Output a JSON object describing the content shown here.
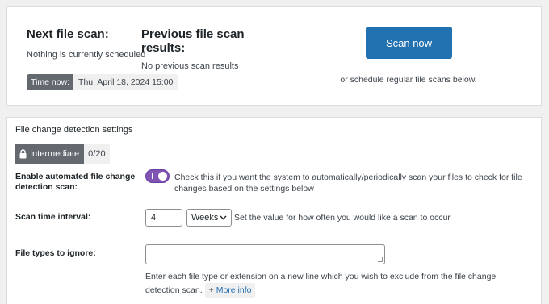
{
  "scan": {
    "next_title": "Next file scan:",
    "next_desc": "Nothing is currently scheduled",
    "prev_title": "Previous file scan results:",
    "prev_desc": "No previous scan results",
    "time_label": "Time now:",
    "time_value": "Thu, April 18, 2024 15:00",
    "button_label": "Scan now",
    "schedule_text": "or schedule regular file scans below."
  },
  "settings": {
    "title": "File change detection settings",
    "level_label": "Intermediate",
    "level_icon": "lock-icon",
    "level_count": "0/20",
    "enable_label": "Enable automated file change detection scan:",
    "enable_on": true,
    "enable_help": "Check this if you want the system to automatically/periodically scan your files to check for file changes based on the settings below",
    "interval_label": "Scan time interval:",
    "interval_value": "4",
    "interval_unit": "Weeks",
    "interval_help": "Set the value for how often you would like a scan to occur",
    "types_label": "File types to ignore:",
    "types_value": "",
    "types_help": "Enter each file type or extension on a new line which you wish to exclude from the file change detection scan.",
    "more_info_label": "More info"
  },
  "colors": {
    "accent": "#2271b1",
    "toggle": "#7f54b3",
    "badge": "#646970"
  }
}
